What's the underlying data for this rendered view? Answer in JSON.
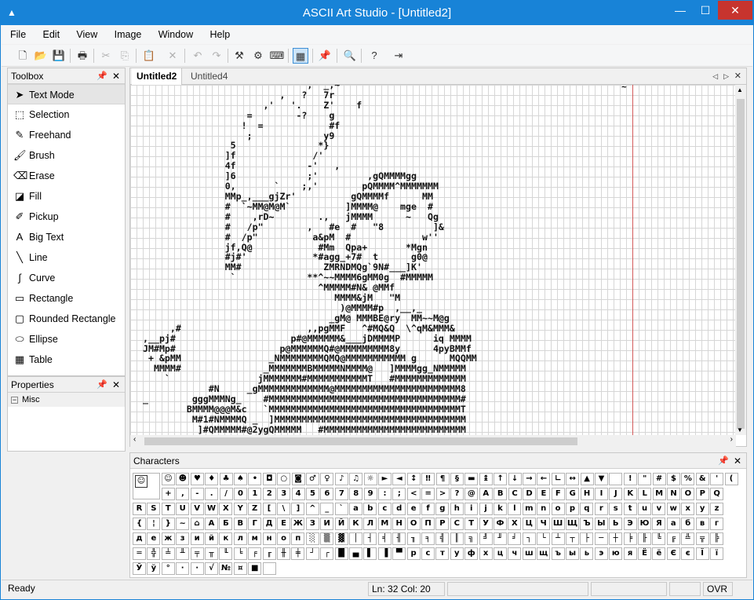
{
  "window": {
    "title": "ASCII Art Studio - [Untitled2]"
  },
  "menu": [
    "File",
    "Edit",
    "View",
    "Image",
    "Window",
    "Help"
  ],
  "toolbox": {
    "title": "Toolbox",
    "items": [
      {
        "label": "Text Mode",
        "icon": "cursor-icon",
        "glyph": "➤",
        "selected": true
      },
      {
        "label": "Selection",
        "icon": "selection-icon",
        "glyph": "⬚"
      },
      {
        "label": "Freehand",
        "icon": "pencil-icon",
        "glyph": "✎"
      },
      {
        "label": "Brush",
        "icon": "brush-icon",
        "glyph": "🖌"
      },
      {
        "label": "Erase",
        "icon": "eraser-icon",
        "glyph": "⌫"
      },
      {
        "label": "Fill",
        "icon": "bucket-icon",
        "glyph": "◪"
      },
      {
        "label": "Pickup",
        "icon": "eyedropper-icon",
        "glyph": "✐"
      },
      {
        "label": "Big Text",
        "icon": "big-text-icon",
        "glyph": "A"
      },
      {
        "label": "Line",
        "icon": "line-icon",
        "glyph": "╲"
      },
      {
        "label": "Curve",
        "icon": "curve-icon",
        "glyph": "∫"
      },
      {
        "label": "Rectangle",
        "icon": "rectangle-icon",
        "glyph": "▭"
      },
      {
        "label": "Rounded Rectangle",
        "icon": "rounded-rectangle-icon",
        "glyph": "▢"
      },
      {
        "label": "Ellipse",
        "icon": "ellipse-icon",
        "glyph": "⬭"
      },
      {
        "label": "Table",
        "icon": "table-icon",
        "glyph": "▦"
      }
    ]
  },
  "properties": {
    "title": "Properties",
    "category": "Misc"
  },
  "tabs": [
    "Untitled2",
    "Untitled4"
  ],
  "art": "                              ,'^_,~\n                         ,   ?   7r\n                      ,'   '.    Z'    f\n                   =        -?    g\n                  !  =            #f\n                   ;             y9\n                5               *}\n               ]f              /'\n               4f             -'   ,\n               ]6             ;'         ,gQMMMMgg\n               0,       `    ;,'        pQMMMM^MMMMMMM\n               MMp_,___gjZr'          gQMMMMf      MM\n               #  `~MM@M@M`          ]MMMM@    mge  #\n               #    ,rD~        .,   jMMMM      ~   Qg\n               #   /p\"        ,   #e  #   \"8         ]&\n               #  /p\"          a&pM  #             w''\n               jf,Q@            #Mm  Qpa+       *Mgn\n               #j#'            *#agg_+7#  t      g0@\n               MM#               ZMRNDMQg`9N#___]K'\n                `             **^~~MMMM6gMM0g  #MMMMM\n                                ^MMMMM#N& @MMf\n                                   MMMM&jM   \"M\n                                    )@MMMM#p  ,__,_\n                                  _gM@ MMMBE@ry  MM~~M@g\n     ,#                       ,,pgMMF   ^#MQ&Q  \\^qM&MMM&\n,__pj#                     p#@MMMMMM&___jDMMMMP      iq MMMM\nJM#Mp#                   p@MMMMMMQ#@MMMMMMMMM8y      4pyBMMf\n + &pMM                _NMMMMMMMMQMQ@MMMMMMMMMMM g      MQQMM\n  MMMM#               _MMMMMMMBMMMMMNMMMM@   ]MMMMgg_NMMMMM\n    `                jMMMMMMM#MMMMMMMMMMMT   #MMMMMMMMMMMMM\n            #N     _gMMMMMMMMMMMMM@MMMMMMMMMMMMMMMMMMMMMMM8\n_        gggMMMNg_    #MMMMMMMMMMMMMMMMMMMMMMMMMMMMMMMMMMM#\n        BMMMM@@@M&c   `MMMMMMMMMMMMMMMMMMMMMMMMMMMMMMMMMMMT\n         M#1#NMMMMQ _  ]MMMMMMMMMMMMMMMMMMMMMMMMMMMMMMMMMMM\n          ]#QMMMMM#@2ygQMMMMM   #MMMMMMMMMMMMMMMMMMMMMMMMMM\n          ]MMMMMM#NMMMMMMMM`    ]MMMMMMMMMMMMMMMMMMMMMMMMMM   .\n           `QMMMMMMMMMM@~       #MMMMMMMMMMMMMMMMMMMMMMMMM8",
  "art_top_mark": "~",
  "characters": {
    "title": "Characters",
    "rows": [
      [
        "☺",
        "☻",
        "♥",
        "♦",
        "♣",
        "♠",
        "•",
        "◘",
        "○",
        "◙",
        "♂",
        "♀",
        "♪",
        "♫",
        "☼",
        "►",
        "◄",
        "↕",
        "‼",
        "¶",
        "§",
        "▬",
        "↨",
        "↑",
        "↓",
        "→",
        "←",
        "∟",
        "↔",
        "▲",
        "▼",
        " ",
        "!",
        "\"",
        "#",
        "$",
        "%",
        "&",
        "'",
        "(",
        ")",
        "*"
      ],
      [
        "+",
        ",",
        "-",
        ".",
        "/",
        "0",
        "1",
        "2",
        "3",
        "4",
        "5",
        "6",
        "7",
        "8",
        "9",
        ":",
        ";",
        "<",
        "=",
        ">",
        "?",
        "@",
        "A",
        "B",
        "C",
        "D",
        "E",
        "F",
        "G",
        "H",
        "I",
        "J",
        "K",
        "L",
        "M",
        "N",
        "O",
        "P",
        "Q"
      ],
      [
        "R",
        "S",
        "T",
        "U",
        "V",
        "W",
        "X",
        "Y",
        "Z",
        "[",
        "\\",
        "]",
        "^",
        "_",
        "`",
        "a",
        "b",
        "c",
        "d",
        "e",
        "f",
        "g",
        "h",
        "i",
        "j",
        "k",
        "l",
        "m",
        "n",
        "o",
        "p",
        "q",
        "r",
        "s",
        "t",
        "u",
        "v",
        "w",
        "x",
        "y",
        "z"
      ],
      [
        "{",
        "¦",
        "}",
        "~",
        "⌂",
        "А",
        "Б",
        "В",
        "Г",
        "Д",
        "Е",
        "Ж",
        "З",
        "И",
        "Й",
        "К",
        "Л",
        "М",
        "Н",
        "О",
        "П",
        "Р",
        "С",
        "Т",
        "У",
        "Ф",
        "Х",
        "Ц",
        "Ч",
        "Ш",
        "Щ",
        "Ъ",
        "Ы",
        "Ь",
        "Э",
        "Ю",
        "Я",
        "а",
        "б",
        "в",
        "г"
      ],
      [
        "д",
        "е",
        "ж",
        "з",
        "и",
        "й",
        "к",
        "л",
        "м",
        "н",
        "о",
        "п",
        "░",
        "▒",
        "▓",
        "│",
        "┤",
        "╡",
        "╢",
        "╖",
        "╕",
        "╣",
        "║",
        "╗",
        "╝",
        "╜",
        "╛",
        "┐",
        "└",
        "┴",
        "┬",
        "├",
        "─",
        "┼",
        "╞",
        "╟",
        "╚",
        "╔",
        "╩",
        "╦",
        "╠"
      ],
      [
        "═",
        "╬",
        "╧",
        "╨",
        "╤",
        "╥",
        "╙",
        "╘",
        "╒",
        "╓",
        "╫",
        "╪",
        "┘",
        "┌",
        "█",
        "▄",
        "▌",
        "▐",
        "▀",
        "р",
        "с",
        "т",
        "у",
        "ф",
        "х",
        "ц",
        "ч",
        "ш",
        "щ",
        "ъ",
        "ы",
        "ь",
        "э",
        "ю",
        "я",
        "Ё",
        "ё",
        "Є",
        "є",
        "Ї",
        "ї"
      ],
      [
        "Ў",
        "ў",
        "°",
        "∙",
        "·",
        "√",
        "№",
        "¤",
        "■",
        " "
      ]
    ]
  },
  "status": {
    "ready": "Ready",
    "position": "Ln: 32  Col: 20",
    "mode": "OVR"
  },
  "colors": {
    "titlebar": "#1883d7",
    "close": "#c7342e",
    "margin_line": "#d35a5a"
  }
}
